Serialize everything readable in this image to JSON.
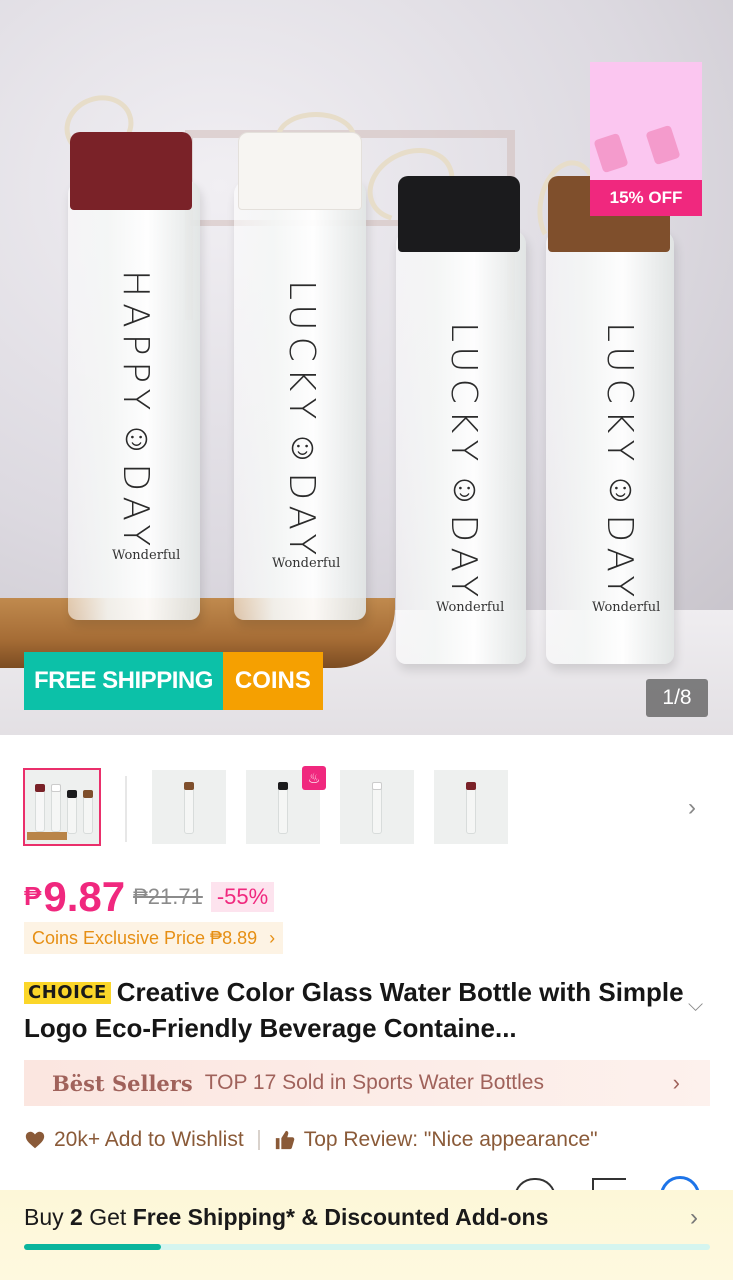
{
  "hero": {
    "bottles": [
      {
        "text": "HAPPY☺DAY",
        "sub": "Wonderful",
        "cap_color": "#7a2228"
      },
      {
        "text": "LUCKY☺DAY",
        "sub": "Wonderful",
        "cap_color": "#f7f5f2"
      },
      {
        "text": "LUCKY☺DAY",
        "sub": "Wonderful",
        "cap_color": "#1b1b1d"
      },
      {
        "text": "LUCKY☺DAY",
        "sub": "Wonderful",
        "cap_color": "#7f4f2c"
      }
    ],
    "discount_badge": "15% OFF",
    "free_shipping_tag": "FREE SHIPPING",
    "coins_tag": "COINS",
    "pager": "1/8"
  },
  "thumbnails": {
    "count": 5,
    "active_index": 0,
    "fire_badge_icon": "fire-icon"
  },
  "price": {
    "currency": "₱",
    "current": "9.87",
    "original": "₱21.71",
    "discount": "-55%",
    "coins_exclusive": "Coins Exclusive Price ₱8.89"
  },
  "product": {
    "choice_badge": "CHOICE",
    "title": "Creative Color Glass Water Bottle with Simple Logo Eco-Friendly Beverage Containe..."
  },
  "best_sellers": {
    "label": "Bëst Sellers",
    "rank": "TOP 17 Sold in Sports Water Bottles"
  },
  "social": {
    "wishlist": "20k+ Add to Wishlist",
    "review": "Top Review: \"Nice appearance\""
  },
  "banner": {
    "prefix": "Buy ",
    "qty": "2",
    "middle": " Get ",
    "offer": "Free Shipping* & Discounted Add-ons",
    "progress": 0.2
  },
  "colors": {
    "accent": "#f0287e",
    "free_shipping": "#0cc1a8",
    "coins": "#f5a001",
    "brown_text": "#8a5a38"
  }
}
